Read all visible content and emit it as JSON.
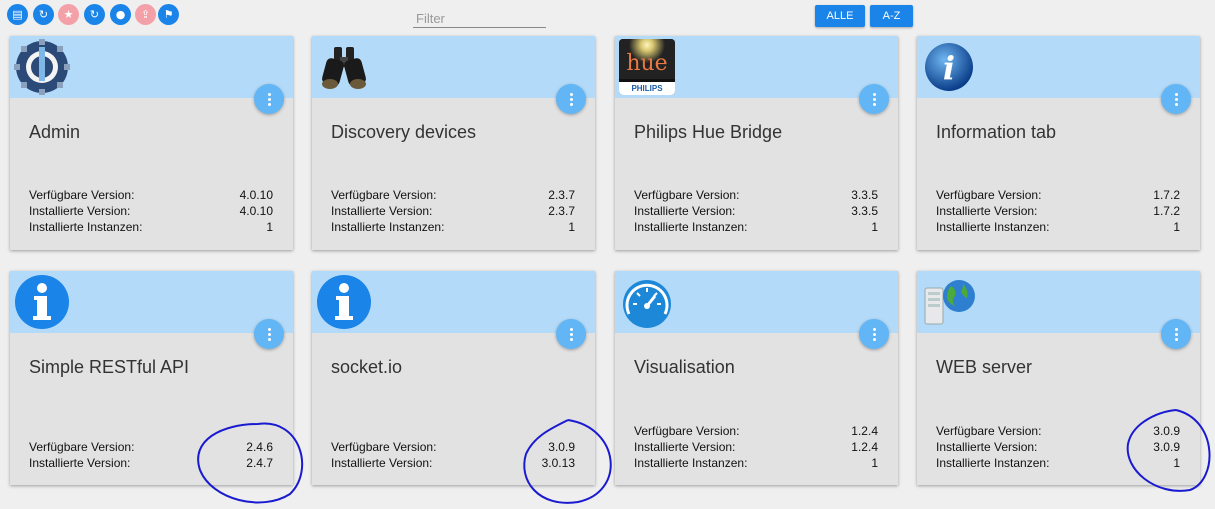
{
  "toolbar": {
    "buttons": [
      {
        "icon": "list-icon",
        "glyph": "▤",
        "color": "#1a84e8"
      },
      {
        "icon": "refresh-icon",
        "glyph": "↻",
        "color": "#1a84e8"
      },
      {
        "icon": "star-icon",
        "glyph": "★",
        "color": "#f4a0a8"
      },
      {
        "icon": "update-check-icon",
        "glyph": "↻",
        "color": "#1a84e8"
      },
      {
        "icon": "github-icon",
        "glyph": "●",
        "color": "#1a84e8"
      },
      {
        "icon": "upload-icon",
        "glyph": "⇪",
        "color": "#f4a0a8"
      },
      {
        "icon": "flag-icon",
        "glyph": "⚑",
        "color": "#1a84e8"
      }
    ],
    "filter_placeholder": "Filter",
    "all_label": "ALLE",
    "az_label": "A-Z"
  },
  "labels": {
    "available": "Verfügbare Version:",
    "installed": "Installierte Version:",
    "instances": "Installierte Instanzen:"
  },
  "cards": [
    {
      "title": "Admin",
      "icon": "admin-logo-icon",
      "available": "4.0.10",
      "installed": "4.0.10",
      "instances": "1"
    },
    {
      "title": "Discovery devices",
      "icon": "binoculars-icon",
      "available": "2.3.7",
      "installed": "2.3.7",
      "instances": "1"
    },
    {
      "title": "Philips Hue Bridge",
      "icon": "philips-hue-logo-icon",
      "logo_text": "hue",
      "logo_brand": "PHILIPS",
      "available": "3.3.5",
      "installed": "3.3.5",
      "instances": "1"
    },
    {
      "title": "Information tab",
      "icon": "info-globe-icon",
      "available": "1.7.2",
      "installed": "1.7.2",
      "instances": "1"
    },
    {
      "title": "Simple RESTful API",
      "icon": "info-circle-icon",
      "available": "2.4.6",
      "installed": "2.4.7"
    },
    {
      "title": "socket.io",
      "icon": "info-circle-icon",
      "available": "3.0.9",
      "installed": "3.0.13"
    },
    {
      "title": "Visualisation",
      "icon": "gauge-icon",
      "available": "1.2.4",
      "installed": "1.2.4",
      "instances": "1"
    },
    {
      "title": "WEB server",
      "icon": "web-server-icon",
      "available": "3.0.9",
      "installed": "3.0.9",
      "instances": "1"
    }
  ],
  "colors": {
    "accent": "#1a84e8",
    "card_header": "#b3dbf9",
    "card_body": "#e2e2e2",
    "menu_button": "#62b6f5",
    "annotation": "#1a1ad0"
  }
}
